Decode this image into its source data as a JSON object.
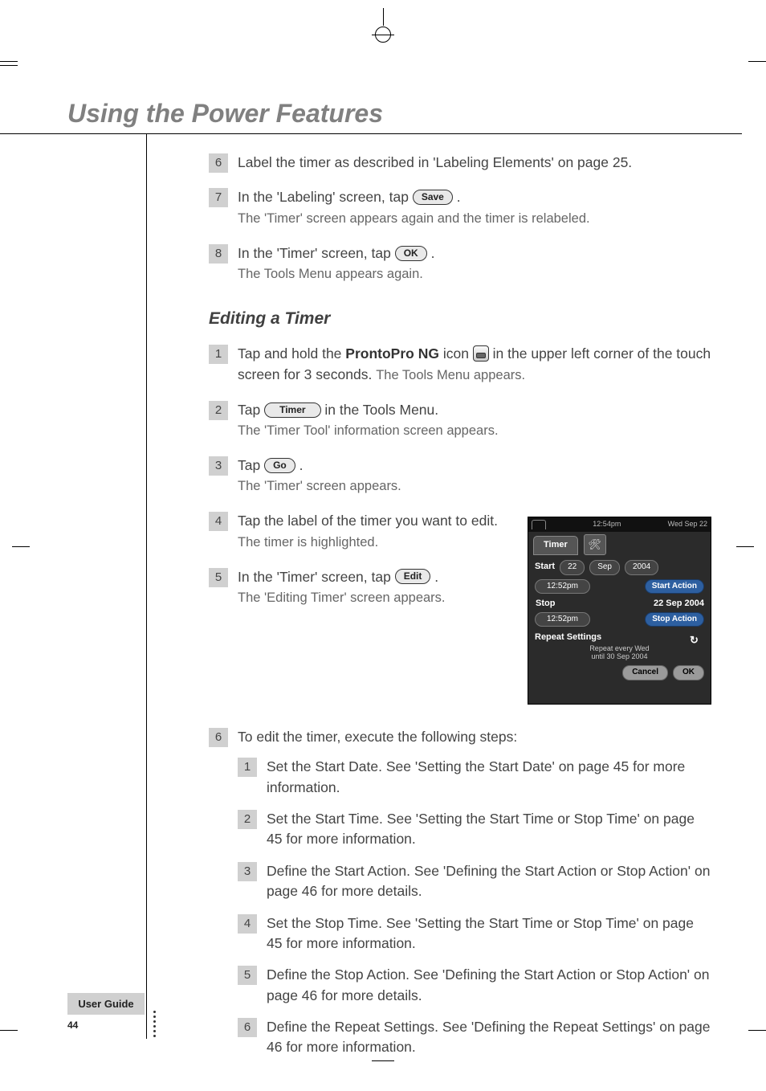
{
  "page": {
    "title": "Using the Power Features",
    "subtitle": "Editing a Timer",
    "user_guide_label": "User Guide",
    "page_number": "44"
  },
  "intro_steps": {
    "step6": {
      "num": "6",
      "text": "Label the timer as described in 'Labeling Elements' on page 25."
    },
    "step7": {
      "num": "7",
      "line1a": "In the 'Labeling' screen, tap ",
      "line1b": ".",
      "btn": "Save",
      "line2": "The 'Timer' screen appears again and the timer is relabeled."
    },
    "step8": {
      "num": "8",
      "line1a": "In the 'Timer' screen, tap ",
      "line1b": ".",
      "btn": "OK",
      "line2": "The Tools Menu appears again."
    }
  },
  "editing_steps": {
    "step1": {
      "num": "1",
      "line1a": "Tap and hold the ",
      "bold1": "ProntoPro NG",
      "line1b": " icon ",
      "line1c": " in the upper left corner of the touch screen for 3 seconds.",
      "line2": " The Tools Menu appears."
    },
    "step2": {
      "num": "2",
      "line1a": "Tap ",
      "btn": "Timer",
      "line1b": " in the Tools Menu.",
      "line2": "The 'Timer Tool' information screen appears."
    },
    "step3": {
      "num": "3",
      "line1a": "Tap ",
      "btn": "Go",
      "line1b": ".",
      "line2": "The 'Timer' screen appears."
    },
    "step4": {
      "num": "4",
      "line1": "Tap the label of the timer you want to edit.",
      "line2": "The timer is highlighted."
    },
    "step5": {
      "num": "5",
      "line1a": "In the 'Timer' screen, tap ",
      "btn": "Edit",
      "line1b": ".",
      "line2": "The 'Editing Timer' screen appears."
    },
    "step6": {
      "num": "6",
      "line1": "To edit the timer, execute the following steps:",
      "substeps": {
        "s1": {
          "num": "1",
          "text": "Set the Start Date. See 'Setting the Start Date' on page 45 for more information."
        },
        "s2": {
          "num": "2",
          "text": "Set the Start Time. See 'Setting the Start Time or Stop Time' on page 45 for more information."
        },
        "s3": {
          "num": "3",
          "text": "Define the Start Action. See 'Defining the Start Action or Stop Action' on page 46 for more details."
        },
        "s4": {
          "num": "4",
          "text": "Set the Stop Time. See 'Setting the Start Time or Stop Time' on page 45 for more information."
        },
        "s5": {
          "num": "5",
          "text": "Define the Stop Action. See 'Defining the Start Action or Stop Action' on page 46 for more details."
        },
        "s6": {
          "num": "6",
          "text": "Define the Repeat Settings. See 'Defining the Repeat Settings' on page 46 for more information."
        }
      }
    }
  },
  "device": {
    "time": "12:54pm",
    "date": "Wed Sep 22",
    "tab": "Timer",
    "start_label": "Start",
    "start_day": "22",
    "start_month": "Sep",
    "start_year": "2004",
    "start_time": "12:52pm",
    "start_action_btn": "Start Action",
    "stop_label": "Stop",
    "stop_date": "22 Sep 2004",
    "stop_time": "12:52pm",
    "stop_action_btn": "Stop Action",
    "repeat_label": "Repeat Settings",
    "repeat_text1": "Repeat every Wed",
    "repeat_text2": "until 30 Sep 2004",
    "cancel_btn": "Cancel",
    "ok_btn": "OK"
  }
}
